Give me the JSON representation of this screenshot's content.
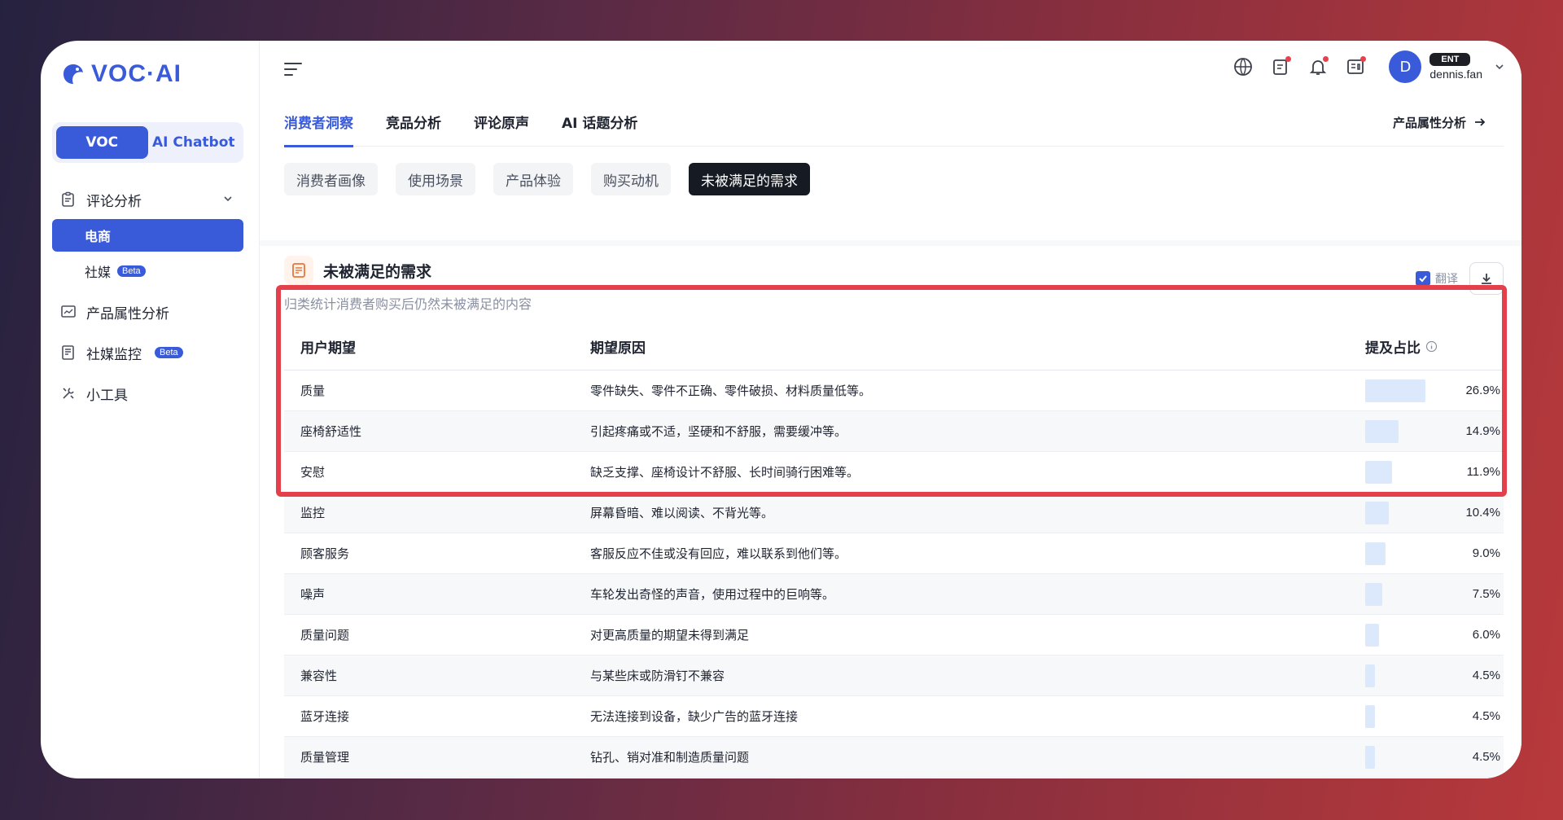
{
  "brand": {
    "name": "VOC·AI"
  },
  "mode_toggle": {
    "voc": "VOC",
    "chatbot": "AI Chatbot"
  },
  "sidebar": {
    "review_analysis": "评论分析",
    "ecommerce": "电商",
    "social": "社媒",
    "beta": "Beta",
    "product_attr": "产品属性分析",
    "social_monitor": "社媒监控",
    "tools": "小工具"
  },
  "user": {
    "initial": "D",
    "plan": "ENT",
    "name": "dennis.fan"
  },
  "tabs": [
    {
      "label": "消费者洞察",
      "active": true
    },
    {
      "label": "竞品分析",
      "active": false
    },
    {
      "label": "评论原声",
      "active": false
    },
    {
      "label": "AI 话题分析",
      "active": false
    }
  ],
  "tab_right": "产品属性分析",
  "subtabs": [
    {
      "label": "消费者画像",
      "active": false
    },
    {
      "label": "使用场景",
      "active": false
    },
    {
      "label": "产品体验",
      "active": false
    },
    {
      "label": "购买动机",
      "active": false
    },
    {
      "label": "未被满足的需求",
      "active": true
    }
  ],
  "section": {
    "title": "未被满足的需求",
    "description": "归类统计消费者购买后仍然未被满足的内容",
    "translate_label": "翻译",
    "translate_checked": true
  },
  "table": {
    "headers": {
      "expectation": "用户期望",
      "reason": "期望原因",
      "share": "提及占比"
    },
    "rows": [
      {
        "expectation": "质量",
        "reason": "零件缺失、零件不正确、零件破损、材料质量低等。",
        "share": "26.9%",
        "value": 26.9
      },
      {
        "expectation": "座椅舒适性",
        "reason": "引起疼痛或不适，坚硬和不舒服，需要缓冲等。",
        "share": "14.9%",
        "value": 14.9
      },
      {
        "expectation": "安慰",
        "reason": "缺乏支撑、座椅设计不舒服、长时间骑行困难等。",
        "share": "11.9%",
        "value": 11.9
      },
      {
        "expectation": "监控",
        "reason": "屏幕昏暗、难以阅读、不背光等。",
        "share": "10.4%",
        "value": 10.4
      },
      {
        "expectation": "顾客服务",
        "reason": "客服反应不佳或没有回应，难以联系到他们等。",
        "share": "9.0%",
        "value": 9.0
      },
      {
        "expectation": "噪声",
        "reason": "车轮发出奇怪的声音，使用过程中的巨响等。",
        "share": "7.5%",
        "value": 7.5
      },
      {
        "expectation": "质量问题",
        "reason": "对更高质量的期望未得到满足",
        "share": "6.0%",
        "value": 6.0
      },
      {
        "expectation": "兼容性",
        "reason": "与某些床或防滑钉不兼容",
        "share": "4.5%",
        "value": 4.5
      },
      {
        "expectation": "蓝牙连接",
        "reason": "无法连接到设备，缺少广告的蓝牙连接",
        "share": "4.5%",
        "value": 4.5
      },
      {
        "expectation": "质量管理",
        "reason": "钻孔、销对准和制造质量问题",
        "share": "4.5%",
        "value": 4.5
      }
    ]
  },
  "colors": {
    "accent": "#3a5bd9",
    "highlight": "#e3404c",
    "bar": "#dce8fb"
  }
}
